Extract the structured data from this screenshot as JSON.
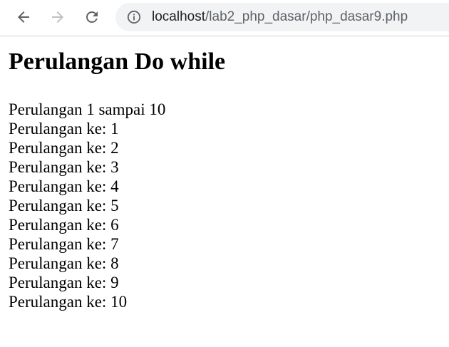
{
  "browser": {
    "url_host": "localhost",
    "url_path": "/lab2_php_dasar/php_dasar9.php",
    "icons": {
      "back": "arrow-left-icon",
      "forward": "arrow-right-icon",
      "reload": "reload-icon",
      "site_info": "info-icon"
    },
    "colors": {
      "omnibox_bg": "#f1f3f4",
      "icon_active": "#5f6368",
      "icon_disabled": "#bdc1c6"
    }
  },
  "page": {
    "title": "Perulangan Do while",
    "heading_line": "Perulangan 1 sampai 10",
    "lines": [
      "Perulangan ke: 1",
      "Perulangan ke: 2",
      "Perulangan ke: 3",
      "Perulangan ke: 4",
      "Perulangan ke: 5",
      "Perulangan ke: 6",
      "Perulangan ke: 7",
      "Perulangan ke: 8",
      "Perulangan ke: 9",
      "Perulangan ke: 10"
    ]
  }
}
